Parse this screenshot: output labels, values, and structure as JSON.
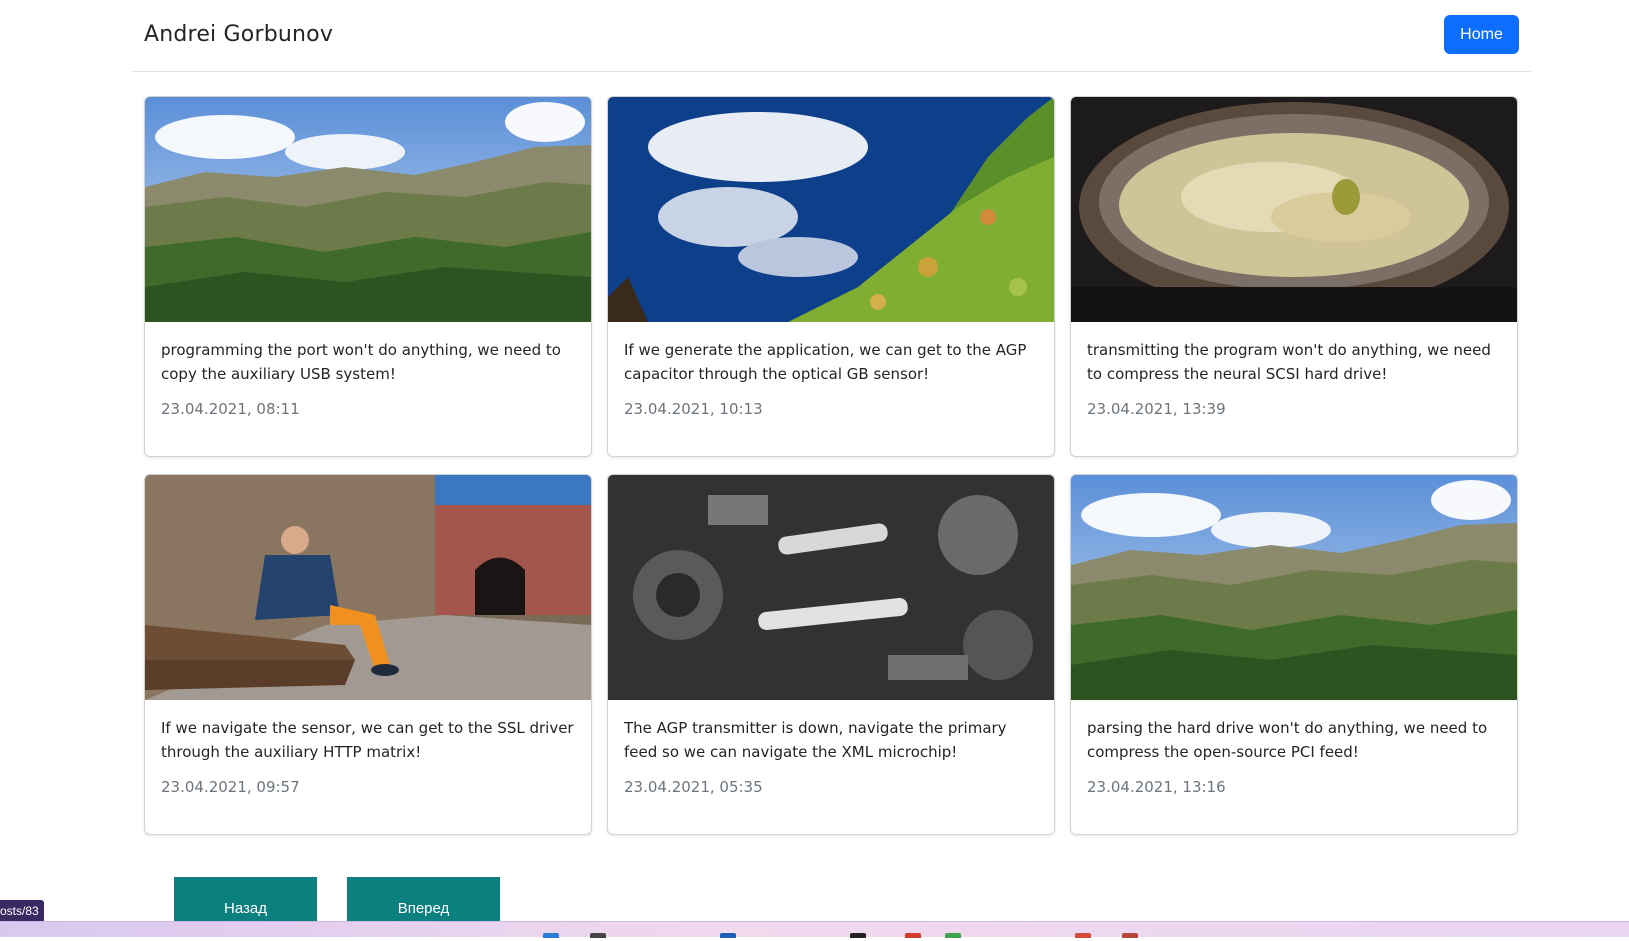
{
  "header": {
    "brand": "Andrei Gorbunov",
    "home_label": "Home",
    "home_color": "#0d6efd"
  },
  "posts": [
    {
      "text": "programming the port won't do anything, we need to copy the auxiliary USB system!",
      "date": "23.04.2021, 08:11",
      "image": "mountain-valley-photo"
    },
    {
      "text": "If we generate the application, we can get to the AGP capacitor through the optical GB sensor!",
      "date": "23.04.2021, 10:13",
      "image": "lily-pads-sky-reflection-photo"
    },
    {
      "text": "transmitting the program won't do anything, we need to compress the neural SCSI hard drive!",
      "date": "23.04.2021, 13:39",
      "image": "pot-of-soup-photo"
    },
    {
      "text": "If we navigate the sensor, we can get to the SSL driver through the auxiliary HTTP matrix!",
      "date": "23.04.2021, 09:57",
      "image": "man-on-bench-photo"
    },
    {
      "text": "The AGP transmitter is down, navigate the primary feed so we can navigate the XML microchip!",
      "date": "23.04.2021, 05:35",
      "image": "machinery-bw-photo"
    },
    {
      "text": "parsing the hard drive won't do anything, we need to compress the open-source PCI feed!",
      "date": "23.04.2021, 13:16",
      "image": "mountain-valley-photo"
    }
  ],
  "pagination": {
    "prev_label": "Назад",
    "next_label": "Вперед",
    "button_color": "#0c7f7f"
  },
  "status_bar": {
    "link_text": "osts/83"
  }
}
